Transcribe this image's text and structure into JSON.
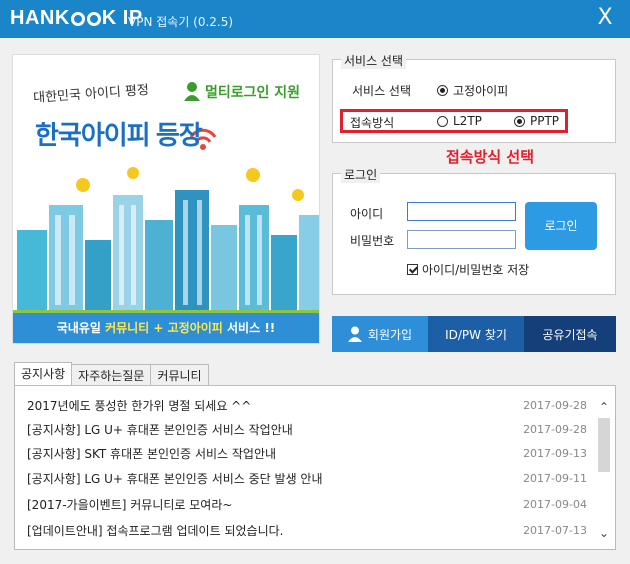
{
  "titlebar": {
    "logo_pre": "HANK",
    "logo_post": "K IP",
    "app_title": "VPN 접속기 (0.2.5)",
    "close_glyph": "X",
    "bg_color": "#1a86c9"
  },
  "banner": {
    "subtitle": "대한민국 아이디 평정",
    "main": "한국아이피 등장",
    "multi_login": "멀티로그인 지원",
    "footer_pre": "국내유일 ",
    "footer_hl": "커뮤니티 + 고정아이피",
    "footer_post": " 서비스 !!"
  },
  "service": {
    "group_title": "서비스 선택",
    "service_label": "서비스 선택",
    "service_option": "고정아이피",
    "method_label": "접속방식",
    "method_options": [
      "L2TP",
      "PPTP"
    ],
    "method_selected": "PPTP",
    "annotation": "접속방식 선택",
    "annotation_color": "#e0202b"
  },
  "login": {
    "group_title": "로그인",
    "id_label": "아이디",
    "pw_label": "비밀번호",
    "id_value": "",
    "pw_value": "",
    "login_button": "로그인",
    "save_label": "아이디/비밀번호 저장",
    "save_checked": true
  },
  "nav": {
    "join": "회원가입",
    "find": "ID/PW 찾기",
    "share": "공유기접속"
  },
  "tabs": [
    "공지사항",
    "자주하는질문",
    "커뮤니티"
  ],
  "notices": [
    {
      "title": "2017년에도 풍성한 한가위 명절 되세요 ^^",
      "date": "2017-09-28"
    },
    {
      "title": "[공지사항] LG U+ 휴대폰 본인인증 서비스 작업안내",
      "date": "2017-09-28"
    },
    {
      "title": "[공지사항] SKT 휴대폰 본인인증 서비스 작업안내",
      "date": "2017-09-13"
    },
    {
      "title": "[공지사항] LG U+ 휴대폰 본인인증 서비스 중단 발생 안내",
      "date": "2017-09-11"
    },
    {
      "title": "[2017-가을이벤트] 커뮤니티로 모여라~",
      "date": "2017-09-04"
    },
    {
      "title": "[업데이트안내] 접속프로그램 업데이트 되었습니다.",
      "date": "2017-07-13"
    }
  ]
}
